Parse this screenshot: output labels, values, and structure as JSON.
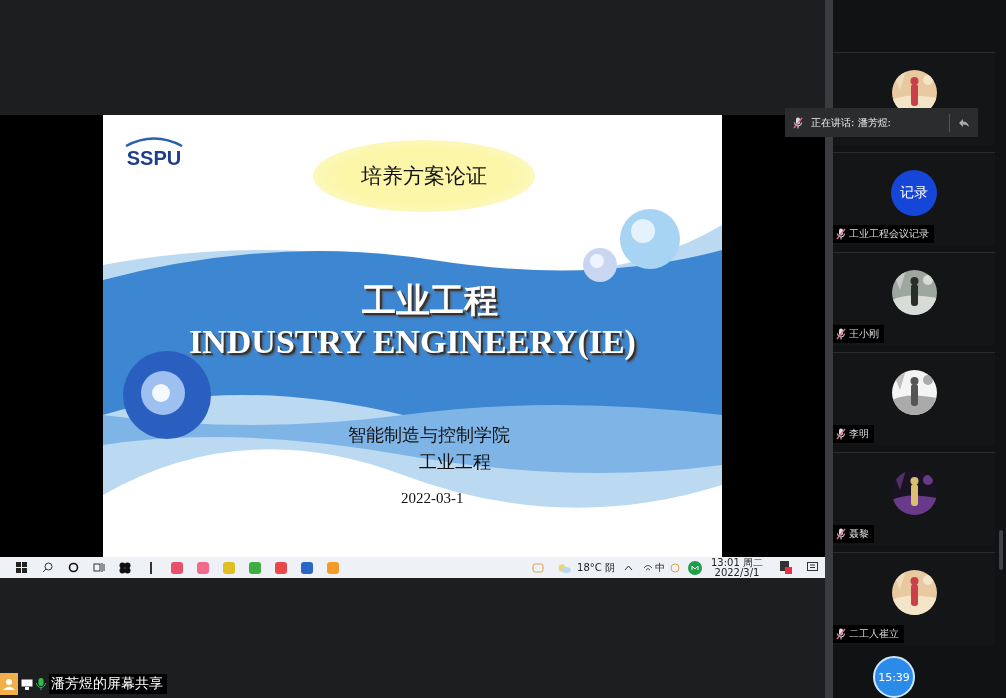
{
  "slide": {
    "logo": "SSPU",
    "banner": "培养方案论证",
    "title": "工业工程",
    "subtitle": "INDUSTRY ENGINEERY(IE)",
    "department": "智能制造与控制学院",
    "major": "工业工程",
    "date": "2022-03-1"
  },
  "taskbar": {
    "apps": [
      {
        "color": "#e8506a"
      },
      {
        "color": "#f06a8a"
      },
      {
        "color": "#e0c020"
      },
      {
        "color": "#3fae3f"
      },
      {
        "color": "#e8484a"
      },
      {
        "color": "#2a66c8"
      },
      {
        "color": "#f39a2a"
      }
    ],
    "weather": "18°C 阴",
    "ime": "中",
    "time": "13:01 周二",
    "date": "2022/3/1"
  },
  "speaking": {
    "label": "正在讲话: 潘芳煜:"
  },
  "participants": [
    {
      "kind": "picture"
    },
    {
      "kind": "badge",
      "badge": "记录",
      "name": "工业工程会议记录",
      "muted": true
    },
    {
      "kind": "picture",
      "name": "王小刚",
      "muted": true
    },
    {
      "kind": "picture",
      "name": "李明",
      "muted": true
    },
    {
      "kind": "picture",
      "name": "聂黎",
      "muted": true
    },
    {
      "kind": "picture",
      "name": "二工人崔立",
      "muted": true
    }
  ],
  "timer": "15:39",
  "share_label": "潘芳煜的屏幕共享"
}
